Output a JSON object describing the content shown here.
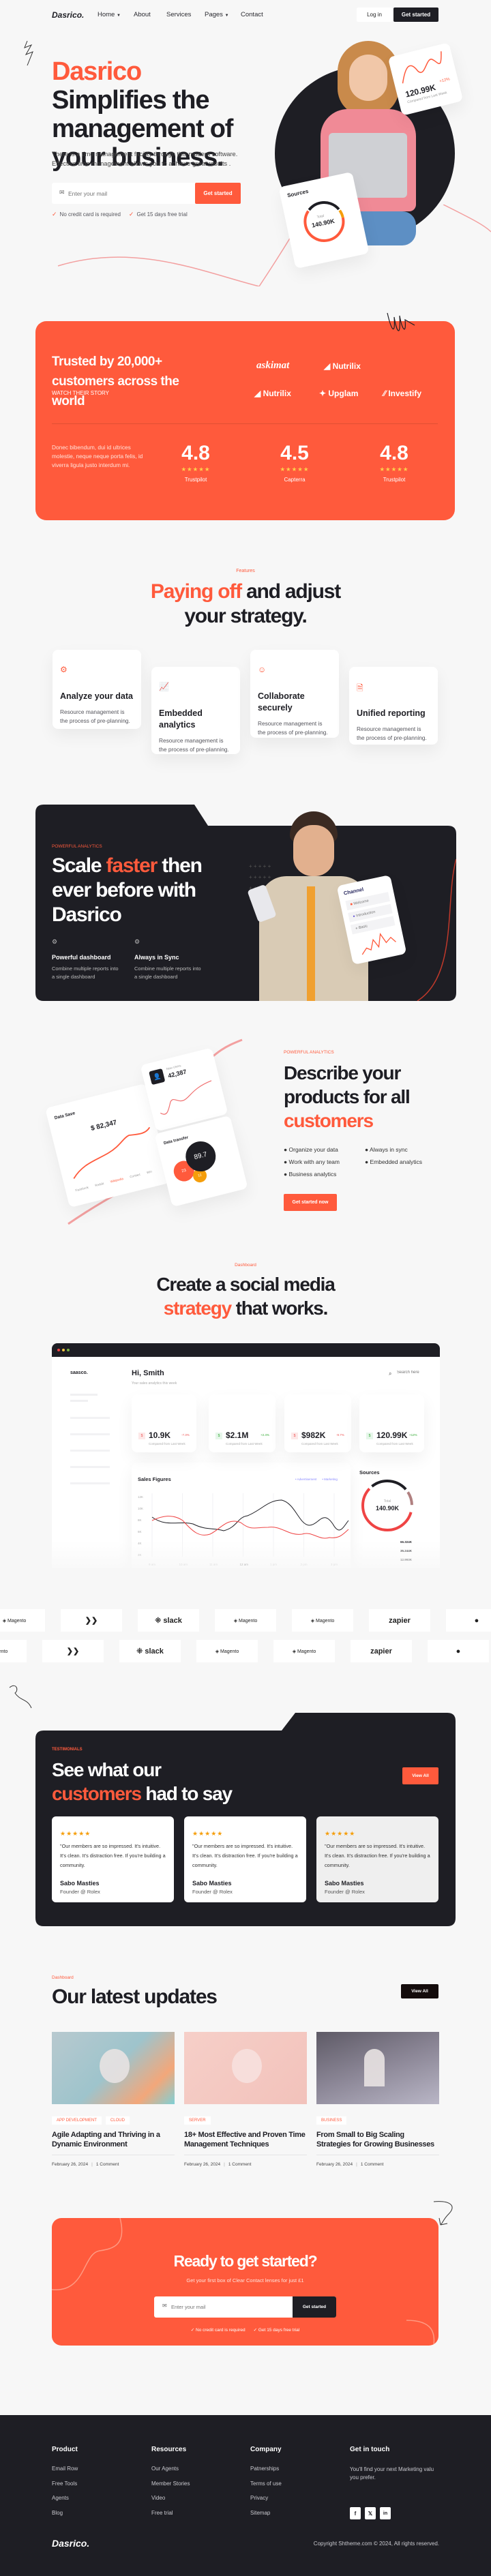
{
  "colors": {
    "accent": "#FF5A3C",
    "dark": "#1E1E24",
    "background": "#F7F7F7"
  },
  "nav": {
    "logo": "Dasrico.",
    "items": [
      "Home",
      "About",
      "Services",
      "Pages",
      "Contact"
    ],
    "login": "Log in",
    "get_started": "Get started"
  },
  "hero": {
    "title_accent": "Dasrico",
    "title_rest": "Simplifies the management of your business.",
    "description": "There is a time management facility through this modern software. Effective time management allows you to achieve great results .",
    "email_placeholder": "Enter your mail",
    "cta": "Get started",
    "checks": [
      "No credit card is required",
      "Get 15 days free trial"
    ],
    "stat_card": {
      "value": "120.99K",
      "change": "+12%",
      "caption": "Compared from Last Week"
    },
    "sources_card": {
      "title": "Sources",
      "total_label": "Total",
      "total": "140.90K"
    }
  },
  "trusted": {
    "heading": "Trusted by 20,000+ customers across the world",
    "link": "WATCH THEIR STORY",
    "logos": [
      "askimat",
      "Nutrilix",
      "Nutrilix",
      "Upglam",
      "Investify"
    ],
    "description": "Donec bibendum, dui id ultrices molestie, neque neque porta felis, id viverra ligula justo interdum mi.",
    "ratings": [
      {
        "score": "4.8",
        "source": "Trustpilot",
        "stars": 5
      },
      {
        "score": "4.5",
        "source": "Capterra",
        "stars": 5
      },
      {
        "score": "4.8",
        "source": "Trustpilot",
        "stars": 5
      }
    ]
  },
  "features": {
    "label": "Features",
    "heading_accent": "Paying off",
    "heading_rest": "and adjust your strategy.",
    "cards": [
      {
        "icon": "gear-icon",
        "title": "Analyze your data",
        "desc": "Resource management is the process of pre-planning."
      },
      {
        "icon": "chart-line-icon",
        "title": "Embedded analytics",
        "desc": "Resource management is the process of pre-planning."
      },
      {
        "icon": "users-icon",
        "title": "Collaborate securely",
        "desc": "Resource management is the process of pre-planning."
      },
      {
        "icon": "document-icon",
        "title": "Unified reporting",
        "desc": "Resource management is the process of pre-planning."
      }
    ]
  },
  "analytics": {
    "label": "POWERFUL ANALYTICS",
    "heading_1": "Scale",
    "heading_accent": "faster",
    "heading_2": "then ever before with Dasrico",
    "items": [
      {
        "title": "Powerful dashboard",
        "desc": "Combine multiple reports into a single dashboard"
      },
      {
        "title": "Always in Sync",
        "desc": "Combine multiple reports into a single dashboard"
      }
    ],
    "channel_card": {
      "title": "Channel",
      "items": [
        "Welcome",
        "Introduction",
        "Basic"
      ]
    }
  },
  "describe": {
    "label": "POWERFUL ANALYTICS",
    "heading": "Describe your products for all",
    "heading_accent": "customers",
    "bullets": [
      "Organize your data",
      "Always in sync",
      "Work with any team",
      "Embedded analytics",
      "Business analytics"
    ],
    "button": "Get started now",
    "mock": {
      "data_save": "Data Save",
      "data_save_value": "$ 82,347",
      "new_users": "New Users",
      "new_users_value": "42,387",
      "data_transfer": "Data transfer",
      "bubbles": [
        "89.7",
        "23",
        "12"
      ],
      "axis": [
        "Facebook",
        "Reddit",
        "Wikipedia",
        "Contact",
        "Win"
      ]
    }
  },
  "dashboard": {
    "label": "Dashboard",
    "heading_1": "Create a social media",
    "heading_accent": "strategy",
    "heading_2": "that works.",
    "app": {
      "logo": "saasco.",
      "greeting": "Hi, Smith",
      "subtitle": "Your sales analytics this week",
      "search_placeholder": "Search here",
      "stats": [
        {
          "value": "10.9K",
          "change": "-7.3%",
          "trend": "down",
          "caption": "Compared from Last Week"
        },
        {
          "value": "$2.1M",
          "change": "+2.4%",
          "trend": "up",
          "caption": "Compared from Last Week"
        },
        {
          "value": "$982K",
          "change": "-9.7%",
          "trend": "down",
          "caption": "Compared from Last Week"
        },
        {
          "value": "120.99K",
          "change": "+12%",
          "trend": "up",
          "caption": "Compared from Last Week"
        }
      ],
      "sales": {
        "title": "Sales Figures",
        "legend": [
          "Advertisement",
          "Marketing"
        ],
        "y_ticks": [
          "12K",
          "10K",
          "8K",
          "6K",
          "4K",
          "2K"
        ],
        "x_ticks": [
          "9 am",
          "10 am",
          "11 am",
          "12 am",
          "1 pm",
          "2 pm",
          "3 pm"
        ]
      },
      "sources": {
        "title": "Sources",
        "total_label": "Total",
        "total": "140.90K",
        "values": [
          "66.324K",
          "35.244K",
          "12.993K"
        ]
      }
    }
  },
  "integrations": {
    "row1": [
      "Magento",
      "jira",
      "slack",
      "Magento",
      "Magento",
      "zapier",
      "github"
    ],
    "row2": [
      "Magento",
      "jira",
      "slack",
      "Magento",
      "Magento",
      "zapier",
      "github"
    ]
  },
  "testimonials": {
    "label": "TESTIMONIALS",
    "heading_1": "See what our",
    "heading_accent": "customers",
    "heading_2": "had to say",
    "view_all": "View All",
    "cards": [
      {
        "quote": "\"Our members are so impressed. It's intuitive. It's clean. It's distraction free. If you're building a community.",
        "name": "Sabo Masties",
        "role": "Founder @ Rolex"
      },
      {
        "quote": "\"Our members are so impressed. It's intuitive. It's clean. It's distraction free. If you're building a community.",
        "name": "Sabo Masties",
        "role": "Founder @ Rolex"
      },
      {
        "quote": "\"Our members are so impressed. It's intuitive. It's clean. It's distraction free. If you're building a community.",
        "name": "Sabo Masties",
        "role": "Founder @ Rolex"
      }
    ]
  },
  "blog": {
    "label": "Dashboard",
    "heading": "Our latest updates",
    "view_all": "View All",
    "posts": [
      {
        "tags": [
          "APP DEVELOPMENT",
          "CLOUD"
        ],
        "title": "Agile Adapting and Thriving in a Dynamic Environment",
        "date": "February 26, 2024",
        "comments": "1 Comment"
      },
      {
        "tags": [
          "SERVER"
        ],
        "title": "18+ Most Effective and Proven Time Management Techniques",
        "date": "February 26, 2024",
        "comments": "1 Comment"
      },
      {
        "tags": [
          "BUSINESS"
        ],
        "title": "From Small to Big Scaling Strategies for Growing Businesses",
        "date": "February 26, 2024",
        "comments": "1 Comment"
      }
    ]
  },
  "cta": {
    "heading": "Ready to get started?",
    "sub": "Get your first box of Clear Contact lenses for just £1",
    "email_placeholder": "Enter your mail",
    "button": "Get started",
    "checks": [
      "No credit card is required",
      "Get 15 days free trial"
    ]
  },
  "footer": {
    "columns": [
      {
        "title": "Product",
        "links": [
          "Email Row",
          "Free Tools",
          "Agents",
          "Blog"
        ]
      },
      {
        "title": "Resources",
        "links": [
          "Our Agents",
          "Member Stories",
          "Video",
          "Free trial"
        ]
      },
      {
        "title": "Company",
        "links": [
          "Patnerships",
          "Terms of use",
          "Privacy",
          "Sitemap"
        ]
      }
    ],
    "contact": {
      "title": "Get in touch",
      "text": "You'll find your next Marketing valu you prefer.",
      "socials": [
        "facebook-icon",
        "x-icon",
        "linkedin-icon"
      ]
    },
    "logo": "Dasrico.",
    "copyright": "Copyright Shtheme.com © 2024, All rights reserved."
  }
}
